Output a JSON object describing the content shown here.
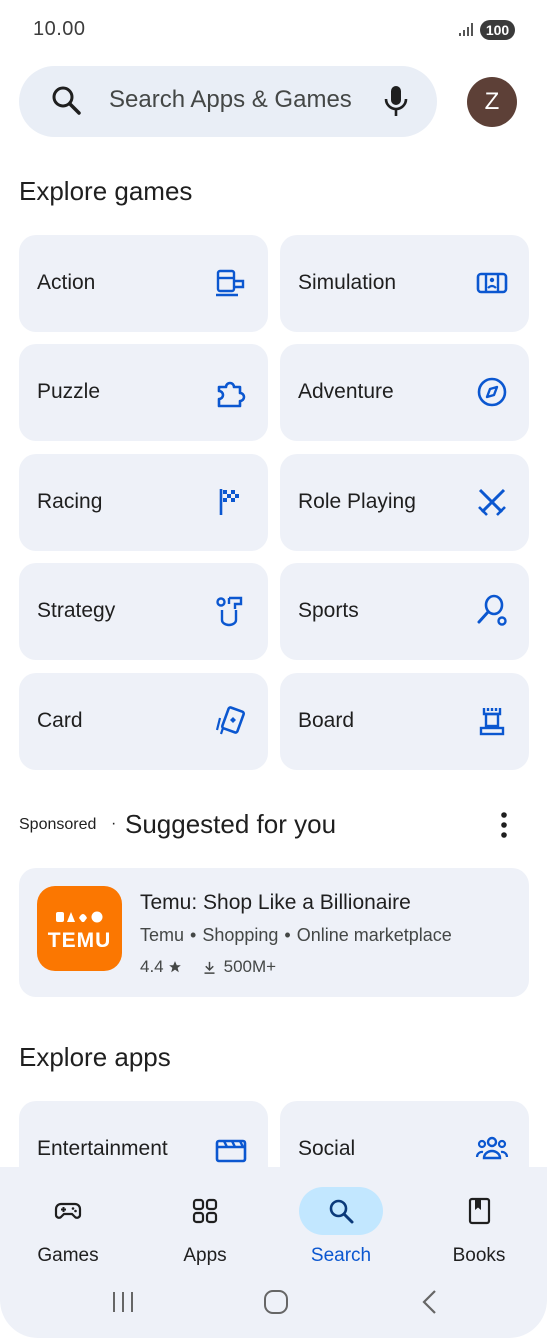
{
  "status": {
    "time": "10.00",
    "battery": "100"
  },
  "search": {
    "placeholder": "Search Apps & Games",
    "avatar_letter": "Z"
  },
  "explore_games": {
    "title": "Explore games",
    "categories": [
      {
        "label": "Action",
        "icon": "action-icon"
      },
      {
        "label": "Simulation",
        "icon": "simulation-icon"
      },
      {
        "label": "Puzzle",
        "icon": "puzzle-icon"
      },
      {
        "label": "Adventure",
        "icon": "compass-icon"
      },
      {
        "label": "Racing",
        "icon": "checkered-flag-icon"
      },
      {
        "label": "Role Playing",
        "icon": "crossed-swords-icon"
      },
      {
        "label": "Strategy",
        "icon": "strategy-icon"
      },
      {
        "label": "Sports",
        "icon": "sports-icon"
      },
      {
        "label": "Card",
        "icon": "cards-icon"
      },
      {
        "label": "Board",
        "icon": "chess-rook-icon"
      }
    ]
  },
  "suggested": {
    "sponsored": "Sponsored",
    "separator": "·",
    "title": "Suggested for you",
    "app": {
      "name": "Temu: Shop Like a Billionaire",
      "logo_text": "TEMU",
      "developer": "Temu",
      "category": "Shopping",
      "tagline": "Online marketplace",
      "meta_separator": "•",
      "rating": "4.4",
      "downloads": "500M+",
      "brand_color": "#fb7701"
    }
  },
  "explore_apps": {
    "title": "Explore apps",
    "categories": [
      {
        "label": "Entertainment",
        "icon": "clapperboard-icon"
      },
      {
        "label": "Social",
        "icon": "people-icon"
      }
    ]
  },
  "bottom_nav": {
    "items": [
      {
        "label": "Games",
        "icon": "gamepad-icon"
      },
      {
        "label": "Apps",
        "icon": "apps-grid-icon"
      },
      {
        "label": "Search",
        "icon": "search-icon",
        "active": true
      },
      {
        "label": "Books",
        "icon": "book-icon"
      }
    ]
  },
  "colors": {
    "accent": "#0b57d0",
    "tile_bg": "#eef1f8",
    "active_pill": "#c2e7ff"
  }
}
